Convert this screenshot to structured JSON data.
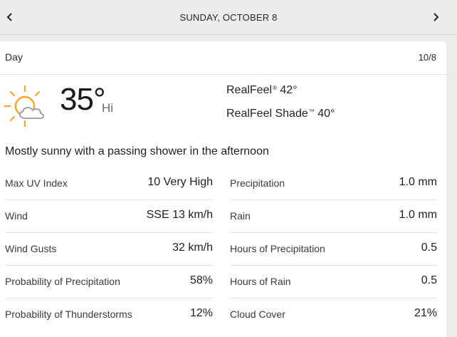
{
  "header": {
    "date_title": "SUNDAY, OCTOBER 8",
    "prev_icon": "chevron-left-icon",
    "next_icon": "chevron-right-icon"
  },
  "card": {
    "period_label": "Day",
    "date_short": "10/8",
    "weather_icon": "sun-with-cloud-icon",
    "temperature": "35°",
    "temperature_label": "Hi",
    "realfeel_label": "RealFeel",
    "realfeel_tm": "®",
    "realfeel_value": "42°",
    "realfeel_shade_label": "RealFeel Shade",
    "realfeel_shade_tm": "™",
    "realfeel_shade_value": "40°",
    "phrase": "Mostly sunny with a passing shower in the afternoon"
  },
  "stats_left": [
    {
      "label": "Max UV Index",
      "value": "10 Very High"
    },
    {
      "label": "Wind",
      "value": "SSE 13 km/h"
    },
    {
      "label": "Wind Gusts",
      "value": "32 km/h"
    },
    {
      "label": "Probability of Precipitation",
      "value": "58%"
    },
    {
      "label": "Probability of Thunderstorms",
      "value": "12%"
    }
  ],
  "stats_right": [
    {
      "label": "Precipitation",
      "value": "1.0 mm"
    },
    {
      "label": "Rain",
      "value": "1.0 mm"
    },
    {
      "label": "Hours of Precipitation",
      "value": "0.5"
    },
    {
      "label": "Hours of Rain",
      "value": "0.5"
    },
    {
      "label": "Cloud Cover",
      "value": "21%"
    }
  ],
  "colors": {
    "sun": "#f5a623",
    "cloud_outline": "#9a9a9a",
    "page_background": "#ececec",
    "card_background": "#ffffff"
  }
}
